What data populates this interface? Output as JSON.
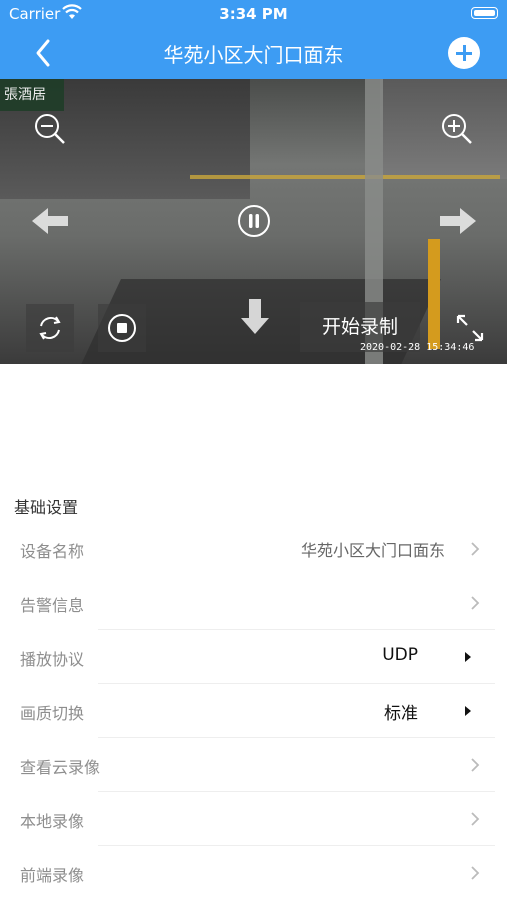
{
  "status_bar": {
    "carrier": "Carrier",
    "time": "3:34 PM"
  },
  "nav": {
    "title": "华苑小区大门口面东"
  },
  "video": {
    "record_label": "开始录制",
    "timestamp": "2020-02-28 15:34:46",
    "shop_sign": "張酒居"
  },
  "settings": {
    "section_title": "基础设置",
    "rows": [
      {
        "label": "设备名称",
        "value": "华苑小区大门口面东"
      },
      {
        "label": "告警信息",
        "value": ""
      },
      {
        "label": "播放协议",
        "value": "UDP"
      },
      {
        "label": "画质切换",
        "value": "标准"
      },
      {
        "label": "查看云录像",
        "value": ""
      },
      {
        "label": "本地录像",
        "value": ""
      },
      {
        "label": "前端录像",
        "value": ""
      }
    ]
  },
  "colors": {
    "accent": "#3d9cf3"
  },
  "icons": [
    "wifi-icon",
    "battery-icon",
    "back-chevron-icon",
    "add-icon",
    "zoom-out-icon",
    "zoom-in-icon",
    "arrow-left-icon",
    "arrow-right-icon",
    "pause-icon",
    "arrow-down-icon",
    "rotate-icon",
    "stop-icon",
    "fullscreen-icon",
    "chevron-right-icon",
    "dropdown-triangle-icon"
  ]
}
